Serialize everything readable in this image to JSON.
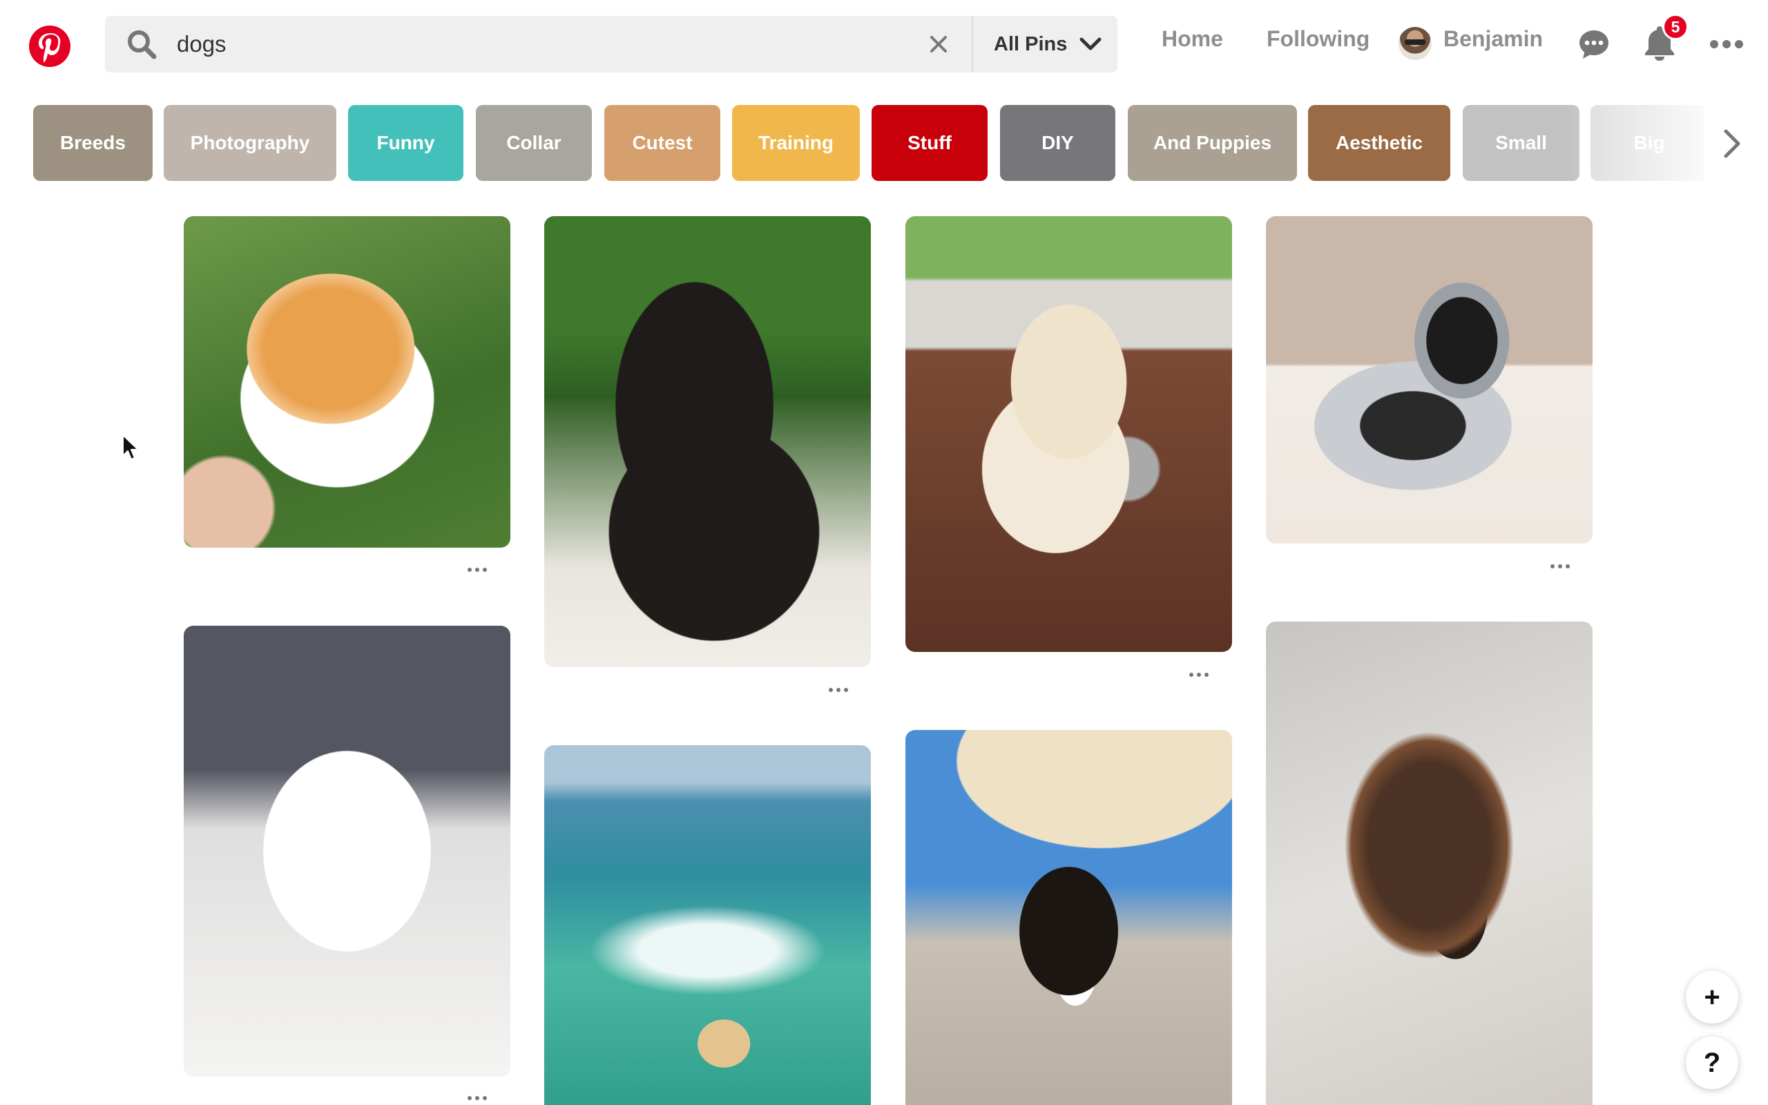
{
  "colors": {
    "brand": "#e60023",
    "icon_gray": "#767676",
    "chips": {
      "breeds": "#9d9281",
      "photography": "#bfb5ac",
      "funny": "#44c0bb",
      "collar": "#a8a69f",
      "cutest": "#d69f6e",
      "training": "#f0b84c",
      "stuff": "#c8000a",
      "diy": "#77767b",
      "and_puppies": "#aaa193",
      "aesthetic": "#9a6b44",
      "small": "#c2c2c2",
      "big": "#dcdcdc"
    }
  },
  "header": {
    "logo_icon": "pinterest-logo",
    "search": {
      "value": "dogs",
      "placeholder": "Search",
      "icon": "search-icon",
      "clear_icon": "close-icon"
    },
    "scope": {
      "label": "All Pins",
      "icon": "chevron-down-icon"
    },
    "nav": {
      "home": "Home",
      "following": "Following"
    },
    "user": {
      "name": "Benjamin"
    },
    "messages_icon": "chat-bubble-icon",
    "notifications": {
      "icon": "bell-icon",
      "count": "5"
    },
    "more_icon": "ellipsis-icon"
  },
  "guides": {
    "chips": [
      "Breeds",
      "Photography",
      "Funny",
      "Collar",
      "Cutest",
      "Training",
      "Stuff",
      "DIY",
      "And Puppies",
      "Aesthetic",
      "Small",
      "Big"
    ],
    "next_icon": "chevron-right-icon"
  },
  "pins": [
    {
      "subject": "orange-pomeranian",
      "more_icon": "ellipsis-icon"
    },
    {
      "subject": "black-puppy",
      "more_icon": "ellipsis-icon"
    },
    {
      "subject": "golden-retriever-puppy",
      "more_icon": "ellipsis-icon"
    },
    {
      "subject": "australian-shepherd-puppy",
      "more_icon": "ellipsis-icon"
    },
    {
      "subject": "white-pomeranian",
      "more_icon": "ellipsis-icon"
    },
    {
      "subject": "dog-swimming-in-wave"
    },
    {
      "subject": "bernese-mountain-puppy"
    },
    {
      "subject": "german-shepherd-puppy"
    }
  ],
  "floating": {
    "add": "+",
    "help": "?"
  }
}
